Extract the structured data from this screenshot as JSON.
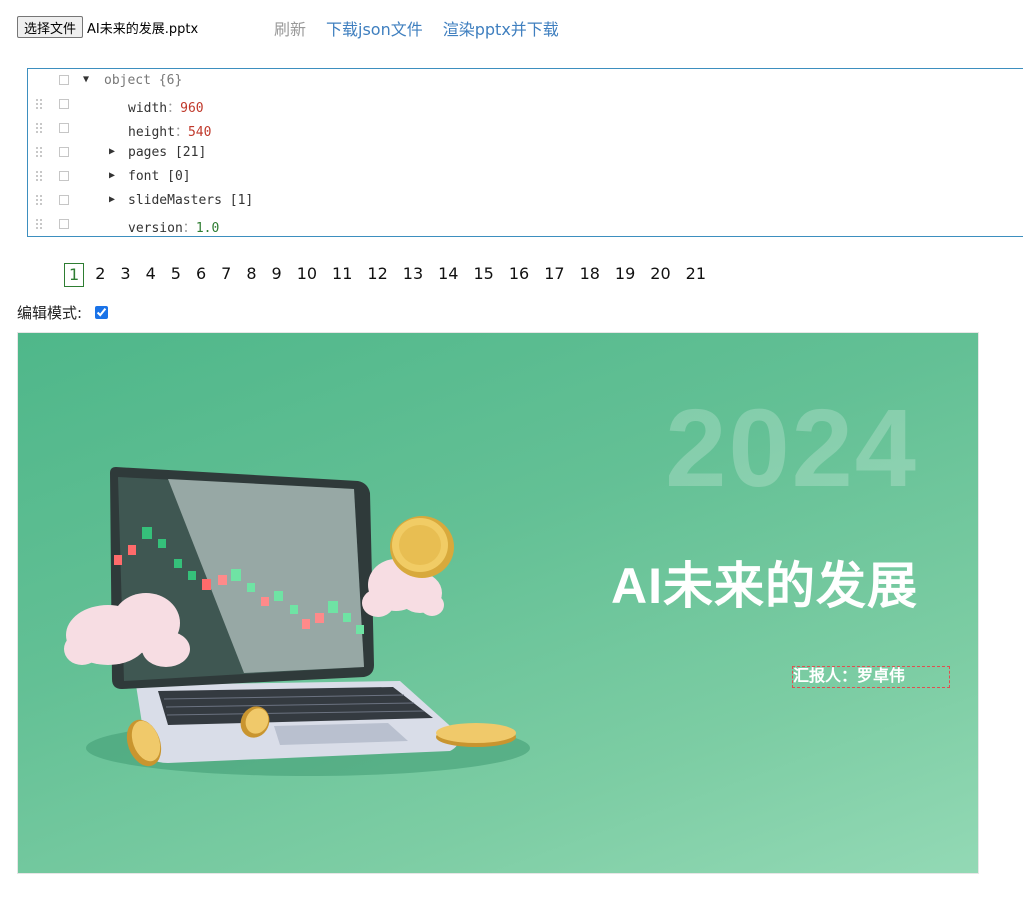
{
  "toolbar": {
    "choose_file_label": "选择文件",
    "file_name": "AI未来的发展.pptx",
    "refresh_label": "刷新",
    "download_json_label": "下载json文件",
    "render_pptx_label": "渲染pptx并下载"
  },
  "tree": {
    "root_label": "object",
    "root_count": "{6}",
    "rows": [
      {
        "key": "width",
        "value": "960"
      },
      {
        "key": "height",
        "value": "540"
      },
      {
        "key": "pages",
        "summary": "[21]"
      },
      {
        "key": "font",
        "summary": "[0]"
      },
      {
        "key": "slideMasters",
        "summary": "[1]"
      },
      {
        "key": "version",
        "value": "1.0"
      }
    ]
  },
  "pager": {
    "pages": [
      "1",
      "2",
      "3",
      "4",
      "5",
      "6",
      "7",
      "8",
      "9",
      "10",
      "11",
      "12",
      "13",
      "14",
      "15",
      "16",
      "17",
      "18",
      "19",
      "20",
      "21"
    ],
    "current": "1"
  },
  "edit_mode": {
    "label": "编辑模式:",
    "checked": true
  },
  "slide": {
    "year": "2024",
    "title": "AI未来的发展",
    "reporter": "汇报人：罗卓伟",
    "colors": {
      "bg_start": "#4fb78a",
      "bg_end": "#93d9b5",
      "laptop_body": "#d8dde6",
      "screen_dark": "#3f5752",
      "coin": "#e9c35a",
      "cloud": "#f6dbe2"
    }
  }
}
